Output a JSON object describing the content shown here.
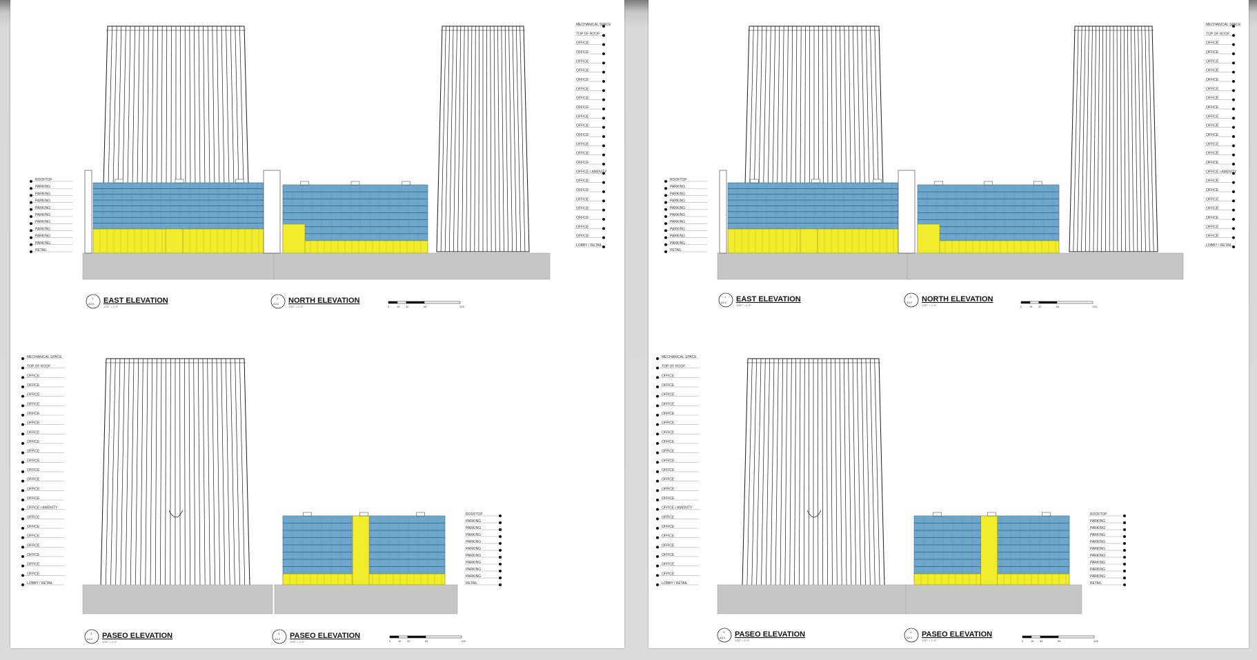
{
  "colors": {
    "parking_glazing": "#6fa7cc",
    "ground_yellow": "#f2ec2e",
    "podium_gray": "#c6c6c6",
    "tower_line": "#1a1a1a"
  },
  "sheets": [
    {
      "name": "left",
      "top_left_title": "EAST ELEVATION",
      "top_left_ref": "1",
      "top_left_sheet": "A3.0",
      "top_left_scale": "1/32\" = 1'-0\"",
      "top_right_title": "NORTH ELEVATION",
      "top_right_ref": "2",
      "top_right_sheet": "A3.0",
      "top_right_scale": "1/32\" = 1'-0\"",
      "bottom_left_title": "PASEO ELEVATION",
      "bottom_left_ref": "3",
      "bottom_left_sheet": "A3.0",
      "bottom_left_scale": "1/32\" = 1'-0\"",
      "bottom_right_title": "PASEO ELEVATION",
      "bottom_right_ref": "4",
      "bottom_right_sheet": "A3.0",
      "bottom_right_scale": "1/32\" = 1'-0\"",
      "top_scale_ticks": [
        "0",
        "16",
        "32",
        "64",
        "128"
      ],
      "bottom_scale_ticks": [
        "0",
        "16",
        "32",
        "64",
        "128"
      ]
    },
    {
      "name": "right",
      "top_left_title": "EAST ELEVATION",
      "top_left_ref": "1",
      "top_left_sheet": "A3.0",
      "top_left_scale": "1/32\" = 1'-0\"",
      "top_right_title": "NORTH ELEVATION",
      "top_right_ref": "2",
      "top_right_sheet": "A3.0",
      "top_right_scale": "1/32\" = 1'-0\"",
      "bottom_left_title": "PASEO ELEVATION",
      "bottom_left_ref": "3",
      "bottom_left_sheet": "A3.0",
      "bottom_left_scale": "1/32\" = 1'-0\"",
      "bottom_right_title": "PASEO ELEVATION",
      "bottom_right_ref": "4",
      "bottom_right_sheet": "A3.0",
      "bottom_right_scale": "1/32\" = 1'-0\"",
      "top_scale_ticks": [
        "0",
        "16",
        "32",
        "64",
        "128"
      ],
      "bottom_scale_ticks": [
        "0",
        "16",
        "32",
        "64",
        "128"
      ]
    }
  ],
  "levels": {
    "podium_labels": [
      "ROOFTOP",
      "PARKING",
      "PARKING",
      "PARKING",
      "PARKING",
      "PARKING",
      "PARKING",
      "PARKING",
      "PARKING",
      "PARKING",
      "RETAIL"
    ],
    "tower_labels": [
      "MECHANICAL SPACE",
      "TOP OF ROOF",
      "OFFICE",
      "OFFICE",
      "OFFICE",
      "OFFICE",
      "OFFICE",
      "OFFICE",
      "OFFICE",
      "OFFICE",
      "OFFICE",
      "OFFICE",
      "OFFICE",
      "OFFICE",
      "OFFICE",
      "OFFICE",
      "OFFICE / AMENITY",
      "OFFICE",
      "OFFICE",
      "OFFICE",
      "OFFICE",
      "OFFICE",
      "OFFICE",
      "OFFICE",
      "LOBBY / RETAIL"
    ]
  }
}
